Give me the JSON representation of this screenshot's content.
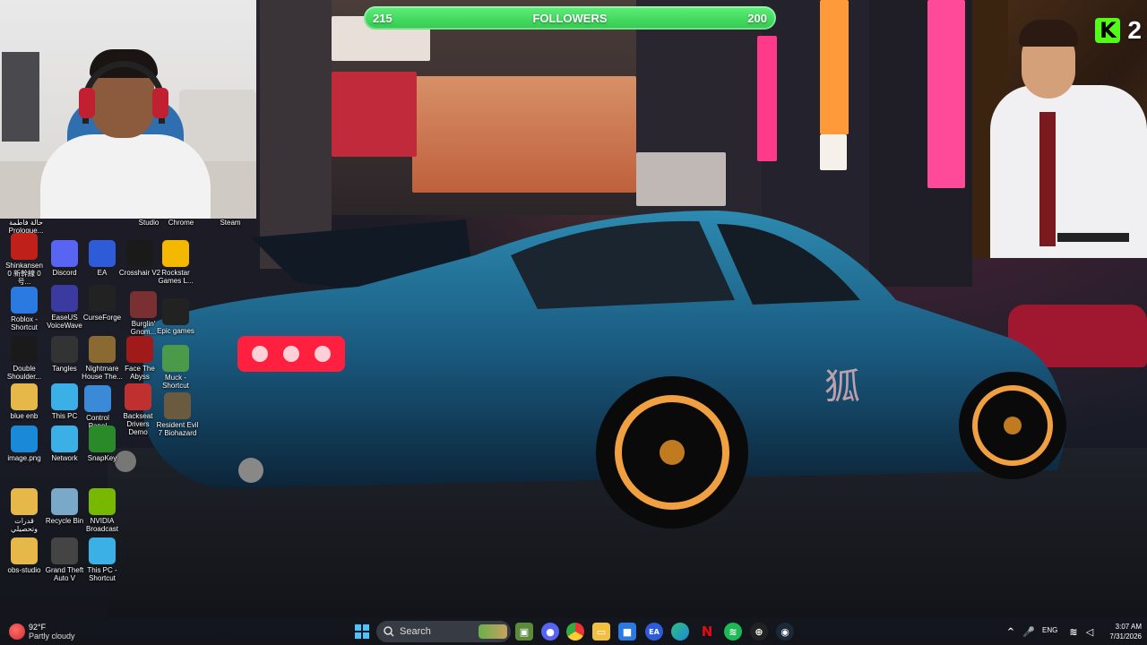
{
  "followers_goal": {
    "current": "215",
    "label": "FOLLOWERS",
    "target": "200"
  },
  "kick": {
    "logo": "K",
    "count": "2"
  },
  "weather": {
    "temperature": "92°F",
    "condition": "Partly cloudy"
  },
  "taskbar": {
    "search_placeholder": "Search"
  },
  "system_tray": {
    "language": "ENG",
    "time": "3:07 AM",
    "date": "7/31/2026"
  },
  "desktop": {
    "icons": [
      {
        "label": "حالة فاطمة Prologue...",
        "icon": "folder-icon",
        "color": "#e6b84a"
      },
      {
        "label": "Studio",
        "icon": "app-icon",
        "color": "#444"
      },
      {
        "label": "Chrome",
        "icon": "chrome-icon",
        "color": "#444"
      },
      {
        "label": "Steam",
        "icon": "steam-icon",
        "color": "#1b2838"
      },
      {
        "label": "Shinkansen 0 新幹線 0号...",
        "icon": "game-icon",
        "color": "#c0201a"
      },
      {
        "label": "Discord",
        "icon": "discord-icon",
        "color": "#5865f2"
      },
      {
        "label": "EA",
        "icon": "ea-icon",
        "color": "#2e5bd8"
      },
      {
        "label": "Crosshair V2",
        "icon": "crosshair-icon",
        "color": "#1a1a1a"
      },
      {
        "label": "Rockstar Games L...",
        "icon": "rockstar-icon",
        "color": "#f5b800"
      },
      {
        "label": "Roblox - Shortcut",
        "icon": "roblox-icon",
        "color": "#2a7ae2"
      },
      {
        "label": "EaseUS VoiceWave",
        "icon": "voicewave-icon",
        "color": "#3a3aa0"
      },
      {
        "label": "CurseForge",
        "icon": "curseforge-icon",
        "color": "#222"
      },
      {
        "label": "Burglin' Gnom...",
        "icon": "game-icon",
        "color": "#7a3030"
      },
      {
        "label": "Epic games",
        "icon": "epic-icon",
        "color": "#222"
      },
      {
        "label": "Double Shoulder...",
        "icon": "ds-icon",
        "color": "#1a1a1a"
      },
      {
        "label": "Tangles",
        "icon": "tangles-icon",
        "color": "#333"
      },
      {
        "label": "Nightmare House The...",
        "icon": "game-icon",
        "color": "#8a6a30"
      },
      {
        "label": "Face The Abyss",
        "icon": "game-icon",
        "color": "#a01a1a"
      },
      {
        "label": "Muck - Shortcut",
        "icon": "muck-icon",
        "color": "#4a9a4a"
      },
      {
        "label": "blue enb",
        "icon": "folder-icon",
        "color": "#e6b84a"
      },
      {
        "label": "This PC",
        "icon": "pc-icon",
        "color": "#3ab0e6"
      },
      {
        "label": "Control Panel",
        "icon": "control-panel-icon",
        "color": "#3a8ad8"
      },
      {
        "label": "Backseat Drivers Demo",
        "icon": "game-icon",
        "color": "#c03030"
      },
      {
        "label": "Resident Evil 7 Biohazard",
        "icon": "game-icon",
        "color": "#6a5a40"
      },
      {
        "label": "image.png",
        "icon": "edge-icon",
        "color": "#1a8ad8"
      },
      {
        "label": "Network",
        "icon": "network-icon",
        "color": "#3ab0e6"
      },
      {
        "label": "SnapKey",
        "icon": "snapkey-icon",
        "color": "#2a8a2a"
      },
      {
        "label": "قدرات وتحصيلي",
        "icon": "folder-icon",
        "color": "#e6b84a"
      },
      {
        "label": "Recycle Bin",
        "icon": "recycle-bin-icon",
        "color": "#7aa8c8"
      },
      {
        "label": "NVIDIA Broadcast",
        "icon": "nvidia-icon",
        "color": "#76b900"
      },
      {
        "label": "obs-studio",
        "icon": "folder-icon",
        "color": "#e6b84a"
      },
      {
        "label": "Grand Theft Auto V",
        "icon": "gta-icon",
        "color": "#444"
      },
      {
        "label": "This PC - Shortcut",
        "icon": "pc-icon",
        "color": "#3ab0e6"
      }
    ]
  }
}
